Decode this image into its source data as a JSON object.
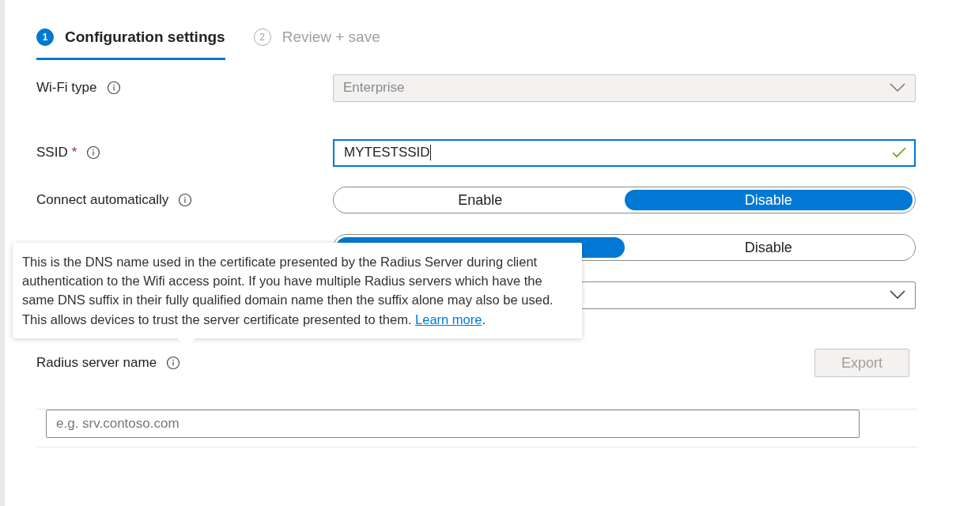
{
  "steps": [
    {
      "number": "1",
      "label": "Configuration settings",
      "selected": true
    },
    {
      "number": "2",
      "label": "Review + save",
      "selected": false
    }
  ],
  "fields": [
    {
      "kind": "dropdown",
      "label": "Wi-Fi type",
      "info": true,
      "value": "Enterprise",
      "disabled": true
    },
    {
      "kind": "text",
      "label": "SSID",
      "required_mark": "*",
      "info": true,
      "value": "MYTESTSSID",
      "valid": true,
      "focused": true
    },
    {
      "kind": "toggle",
      "label": "Connect automatically",
      "info": true,
      "options": [
        {
          "label": "Enable",
          "selected": false
        },
        {
          "label": "Disable",
          "selected": true
        }
      ]
    },
    {
      "kind": "toggle",
      "options": [
        {
          "selected": true
        },
        {
          "label": "Disable",
          "selected": false
        }
      ]
    },
    {
      "kind": "dropdown",
      "disabled": false
    }
  ],
  "radius": {
    "label": "Radius server name",
    "info": true,
    "export_button": {
      "label": "Export",
      "disabled": true
    },
    "input": {
      "placeholder": "e.g. srv.contoso.com"
    }
  },
  "tooltip": {
    "text": "This is the DNS name used in the certificate presented by the Radius Server during client authentication to the Wifi access point. If you have multiple Radius servers which have the same DNS suffix in their fully qualified domain name then the suffix alone may also be used. This allows devices to trust the server certificate presented to them.",
    "link": "Learn more",
    "after": "."
  }
}
